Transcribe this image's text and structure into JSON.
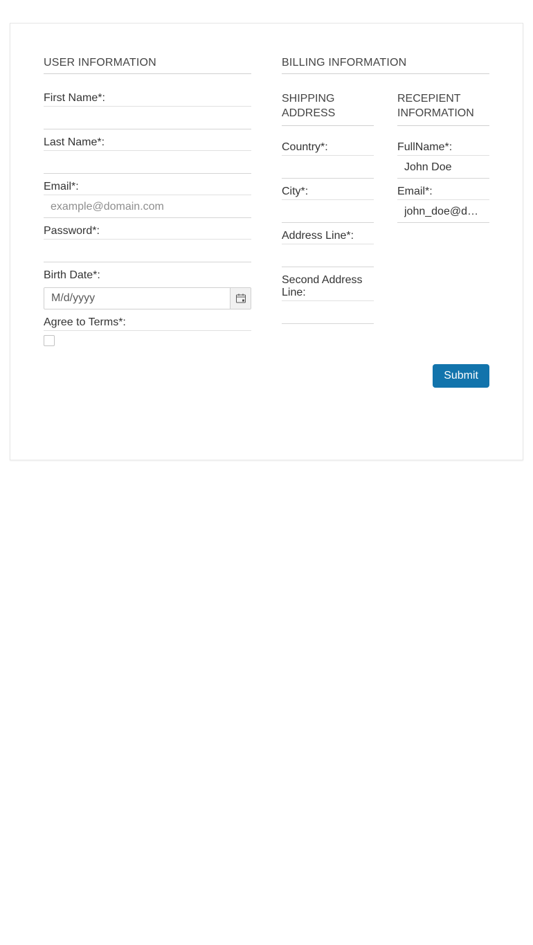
{
  "user_info": {
    "title": "USER INFORMATION",
    "first_name": {
      "label": "First Name*:",
      "value": ""
    },
    "last_name": {
      "label": "Last Name*:",
      "value": ""
    },
    "email": {
      "label": "Email*:",
      "placeholder": "example@domain.com",
      "value": ""
    },
    "password": {
      "label": "Password*:",
      "value": ""
    },
    "birth_date": {
      "label": "Birth Date*:",
      "placeholder": "M/d/yyyy",
      "value": ""
    },
    "agree": {
      "label": "Agree to Terms*:",
      "checked": false
    }
  },
  "billing_info": {
    "title": "BILLING INFORMATION",
    "shipping": {
      "title": "SHIPPING ADDRESS",
      "country": {
        "label": "Country*:",
        "value": ""
      },
      "city": {
        "label": "City*:",
        "value": ""
      },
      "address": {
        "label": "Address Line*:",
        "value": ""
      },
      "address2": {
        "label": "Second Address Line:",
        "value": ""
      }
    },
    "recipient": {
      "title": "RECEPIENT INFORMATION",
      "fullname": {
        "label": "FullName*:",
        "value": "John Doe"
      },
      "email": {
        "label": "Email*:",
        "value": "john_doe@d…"
      }
    }
  },
  "actions": {
    "submit": "Submit"
  },
  "icons": {
    "calendar": "calendar-icon"
  },
  "colors": {
    "accent": "#1274ac",
    "border": "#d5d5d5"
  }
}
